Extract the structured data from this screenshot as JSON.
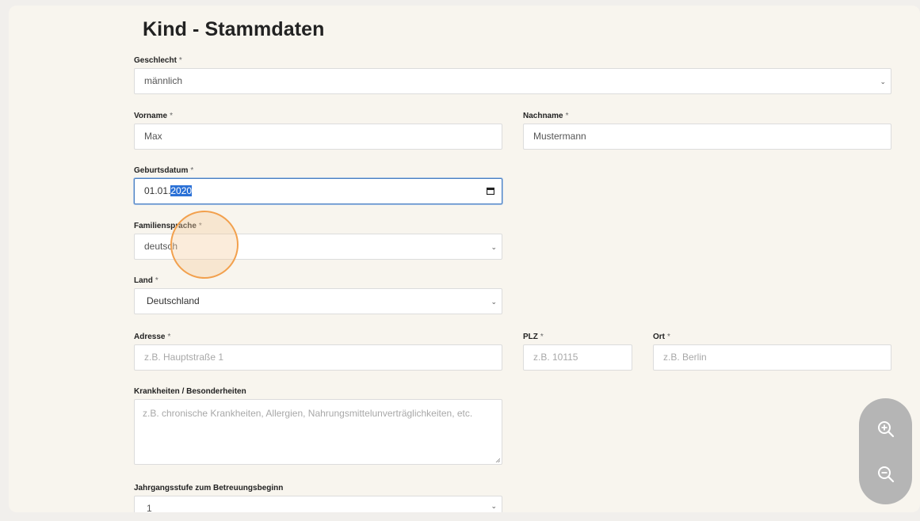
{
  "form": {
    "title": "Kind - Stammdaten",
    "required_marker": "*",
    "geschlecht": {
      "label": "Geschlecht",
      "value": "männlich"
    },
    "vorname": {
      "label": "Vorname",
      "value": "Max"
    },
    "nachname": {
      "label": "Nachname",
      "value": "Mustermann"
    },
    "geburtsdatum": {
      "label": "Geburtsdatum",
      "value_prefix": "01.01.",
      "value_selected": "2020"
    },
    "familiensprache": {
      "label": "Familiensprache",
      "value": "deutsch"
    },
    "land": {
      "label": "Land",
      "value": "Deutschland"
    },
    "adresse": {
      "label": "Adresse",
      "placeholder": "z.B. Hauptstraße 1"
    },
    "plz": {
      "label": "PLZ",
      "placeholder": "z.B. 10115"
    },
    "ort": {
      "label": "Ort",
      "placeholder": "z.B. Berlin"
    },
    "krankheiten": {
      "label": "Krankheiten / Besonderheiten",
      "placeholder": "z.B. chronische Krankheiten, Allergien, Nahrungsmittelunverträglichkeiten, etc."
    },
    "jahrgangsstufe": {
      "label": "Jahrgangsstufe zum Betreuungsbeginn",
      "value": "1"
    }
  },
  "zoom_controls": {
    "zoom_in_icon": "zoom-in-icon",
    "zoom_out_icon": "zoom-out-icon"
  },
  "colors": {
    "accent_ring": "#f2a04d",
    "selection": "#2a70d6",
    "focus_border": "#4a7fc1"
  }
}
